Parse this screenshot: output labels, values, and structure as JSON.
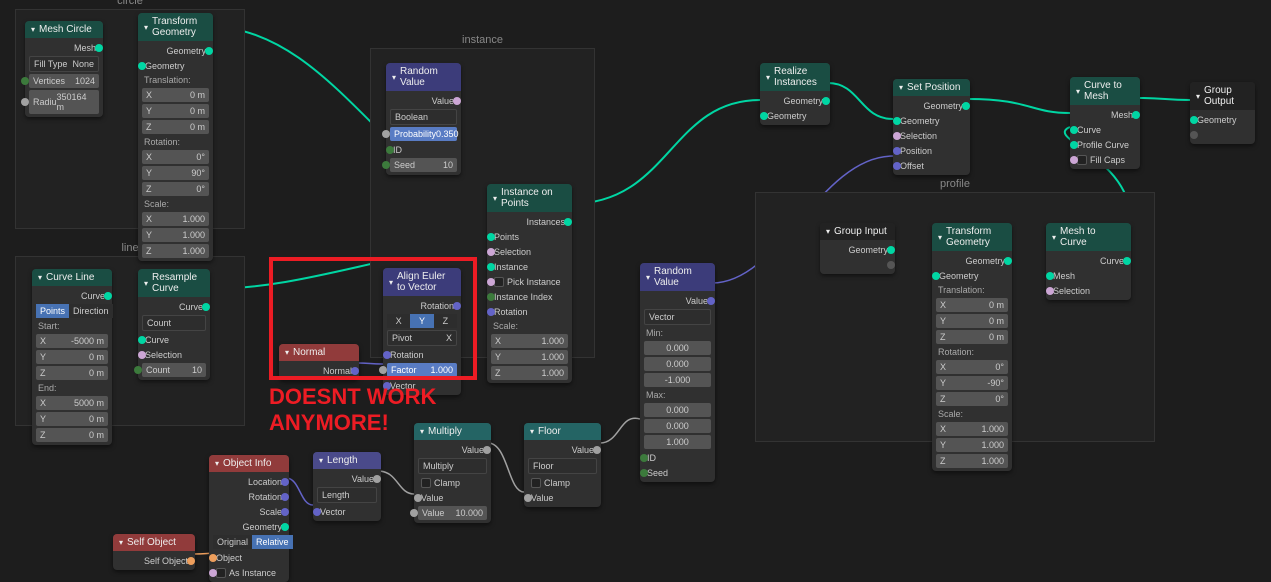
{
  "frames": {
    "circle": "circle",
    "line": "line",
    "instance": "instance",
    "profile": "profile"
  },
  "mesh_circle": {
    "title": "Mesh Circle",
    "out": "Mesh",
    "fill": "Fill Type",
    "fill_v": "None",
    "vert": "Vertices",
    "vert_v": "1024",
    "rad": "Radiu",
    "rad_v": "350164 m"
  },
  "transform1": {
    "title": "Transform Geometry",
    "out": "Geometry",
    "in": "Geometry",
    "tr": "Translation:",
    "rot": "Rotation:",
    "sc": "Scale:",
    "x": "X",
    "y": "Y",
    "z": "Z",
    "tx": "0 m",
    "ty": "0 m",
    "tz": "0 m",
    "rx": "0°",
    "ry": "90°",
    "rz": "0°",
    "sx": "1.000",
    "sy": "1.000",
    "sz": "1.000"
  },
  "curve_line": {
    "title": "Curve Line",
    "out": "Curve",
    "pts": "Points",
    "dir": "Direction",
    "start": "Start:",
    "end": "End:",
    "sx": "-5000 m",
    "sy": "0 m",
    "sz": "0 m",
    "ex": "5000 m",
    "ey": "0 m",
    "ez": "0 m",
    "x": "X",
    "y": "Y",
    "z": "Z"
  },
  "resample": {
    "title": "Resample Curve",
    "out": "Curve",
    "mode": "Count",
    "in1": "Curve",
    "in2": "Selection",
    "cnt": "Count",
    "cnt_v": "10"
  },
  "normal": {
    "title": "Normal",
    "out": "Normal"
  },
  "align": {
    "title": "Align Euler to Vector",
    "out": "Rotation",
    "x": "X",
    "y": "Y",
    "z": "Z",
    "pivot": "Pivot",
    "pivot_v": "X",
    "rot": "Rotation",
    "fac": "Factor",
    "fac_v": "1.000",
    "vec": "Vector"
  },
  "random1": {
    "title": "Random Value",
    "out": "Value",
    "type": "Boolean",
    "prob": "Probability",
    "prob_v": "0.350",
    "id": "ID",
    "seed": "Seed",
    "seed_v": "10"
  },
  "iop": {
    "title": "Instance on Points",
    "out": "Instances",
    "pts": "Points",
    "sel": "Selection",
    "inst": "Instance",
    "pick": "Pick Instance",
    "idx": "Instance Index",
    "rot": "Rotation",
    "sc": "Scale:",
    "x": "X",
    "y": "Y",
    "z": "Z",
    "sx": "1.000",
    "sy": "1.000",
    "sz": "1.000"
  },
  "random2": {
    "title": "Random Value",
    "out": "Value",
    "type": "Vector",
    "min": "Min:",
    "max": "Max:",
    "v0": "0.000",
    "v1": "0.000",
    "v2": "-1.000",
    "m0": "0.000",
    "m1": "0.000",
    "m2": "1.000",
    "id": "ID",
    "seed": "Seed"
  },
  "objinfo": {
    "title": "Object Info",
    "loc": "Location",
    "rot": "Rotation",
    "sc": "Scale",
    "geo": "Geometry",
    "orig": "Original",
    "rel": "Relative",
    "obj": "Object",
    "asinst": "As Instance"
  },
  "selfobj": {
    "title": "Self Object",
    "out": "Self Object"
  },
  "length": {
    "title": "Length",
    "out": "Value",
    "mode": "Length",
    "vec": "Vector"
  },
  "multiply": {
    "title": "Multiply",
    "out": "Value",
    "mode": "Multiply",
    "clamp": "Clamp",
    "val": "Value",
    "v2": "10.000"
  },
  "floor": {
    "title": "Floor",
    "out": "Value",
    "mode": "Floor",
    "clamp": "Clamp",
    "val": "Value"
  },
  "realize": {
    "title": "Realize Instances",
    "out": "Geometry",
    "in": "Geometry"
  },
  "setpos": {
    "title": "Set Position",
    "out": "Geometry",
    "geo": "Geometry",
    "sel": "Selection",
    "pos": "Position",
    "off": "Offset"
  },
  "ctm": {
    "title": "Curve to Mesh",
    "out": "Mesh",
    "curve": "Curve",
    "prof": "Profile Curve",
    "fill": "Fill Caps"
  },
  "mtc": {
    "title": "Mesh to Curve",
    "out": "Curve",
    "mesh": "Mesh",
    "sel": "Selection"
  },
  "groupin": {
    "title": "Group Input",
    "out": "Geometry"
  },
  "groupout": {
    "title": "Group Output",
    "in": "Geometry"
  },
  "transform2": {
    "title": "Transform Geometry",
    "out": "Geometry",
    "in": "Geometry",
    "tr": "Translation:",
    "rot": "Rotation:",
    "sc": "Scale:",
    "x": "X",
    "y": "Y",
    "z": "Z",
    "tx": "0 m",
    "ty": "0 m",
    "tz": "0 m",
    "rx": "0°",
    "ry": "-90°",
    "rz": "0°",
    "sx": "1.000",
    "sy": "1.000",
    "sz": "1.000"
  },
  "annot": "DOESNT WORK\nANYMORE!"
}
